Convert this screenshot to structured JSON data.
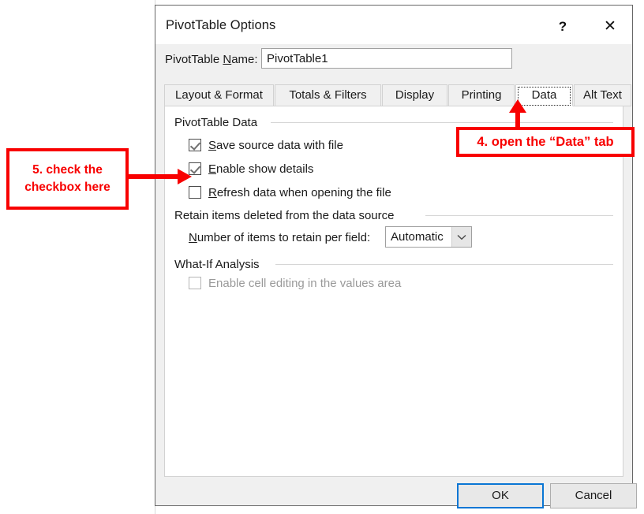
{
  "dialog": {
    "title": "PivotTable Options",
    "help_icon": "?",
    "close_icon": "✕",
    "name_label_pre": "PivotTable ",
    "name_label_accel": "N",
    "name_label_post": "ame:",
    "name_value": "PivotTable1",
    "ok_label": "OK",
    "cancel_label": "Cancel"
  },
  "tabs": [
    {
      "label": "Layout & Format",
      "selected": false
    },
    {
      "label": "Totals & Filters",
      "selected": false
    },
    {
      "label": "Display",
      "selected": false
    },
    {
      "label": "Printing",
      "selected": false
    },
    {
      "label": "Data",
      "selected": true
    },
    {
      "label": "Alt Text",
      "selected": false
    }
  ],
  "groups": {
    "pivottable_data": {
      "heading": "PivotTable Data",
      "checkboxes": [
        {
          "accel": "S",
          "pre": "",
          "post": "ave source data with file",
          "checked": true,
          "disabled": false
        },
        {
          "accel": "E",
          "pre": "",
          "post": "nable show details",
          "checked": true,
          "disabled": false
        },
        {
          "accel": "R",
          "pre": "",
          "post": "efresh data when opening the file",
          "checked": false,
          "disabled": false
        }
      ]
    },
    "retain_items": {
      "heading": "Retain items deleted from the data source",
      "field_label_accel": "N",
      "field_label_post": "umber of items to retain per field:",
      "combo_value": "Automatic",
      "combo_options": [
        "Automatic"
      ]
    },
    "what_if": {
      "heading": "What-If Analysis",
      "checkboxes": [
        {
          "accel": "",
          "pre": "Enable cell editing in the values area",
          "post": "",
          "checked": false,
          "disabled": true
        }
      ]
    }
  },
  "annotations": {
    "left_callout": "5. check the checkbox here",
    "right_callout": "4. open the “Data” tab",
    "accent_color": "#f80000"
  }
}
